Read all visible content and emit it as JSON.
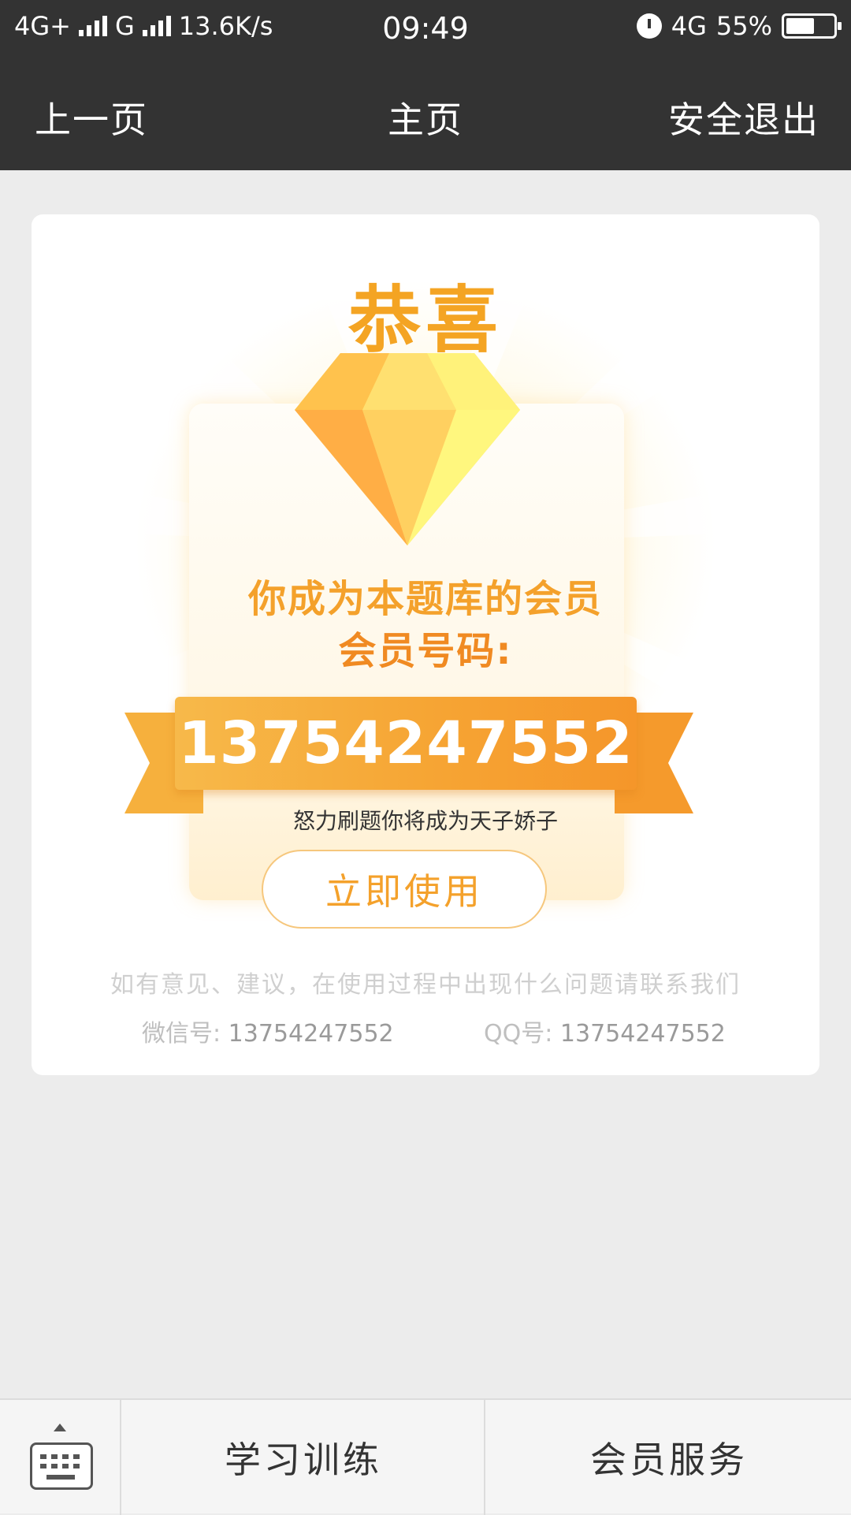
{
  "status_bar": {
    "network_left": "4G+",
    "network_second": "G",
    "speed": "13.6K/s",
    "time": "09:49",
    "network_right": "4G",
    "battery": "55%"
  },
  "nav": {
    "back": "上一页",
    "home": "主页",
    "logout": "安全退出"
  },
  "card": {
    "congrats": "恭喜",
    "member_text": "你成为本题库的会员",
    "member_number_label": "会员号码:",
    "member_number": "13754247552",
    "motto": "怒力刷题你将成为天子娇子",
    "use_button": "立即使用",
    "contact_note": "如有意见、建议，在使用过程中出现什么问题请联系我们",
    "wechat_label": "微信号:",
    "wechat_value": "13754247552",
    "qq_label": "QQ号:",
    "qq_value": "13754247552"
  },
  "bottom_bar": {
    "tab_study": "学习训练",
    "tab_member": "会员服务"
  },
  "colors": {
    "header_bg": "#333333",
    "accent_orange": "#f4a12b",
    "page_bg": "#ececec"
  }
}
